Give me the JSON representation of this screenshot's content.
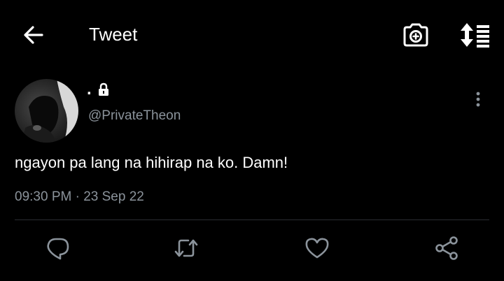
{
  "header": {
    "title": "Tweet",
    "icons": {
      "back": "arrow-left-icon",
      "camera": "camera-add-icon",
      "sort": "sort-list-icon"
    }
  },
  "tweet": {
    "display_name": ".",
    "protected_icon": "lock-icon",
    "handle": "@PrivateTheon",
    "text": "ngayon pa lang na hihirap na ko. Damn!",
    "time": "09:30 PM",
    "separator": " · ",
    "date": "23 Sep 22"
  },
  "actions": {
    "icons": [
      "reply-icon",
      "retweet-icon",
      "like-icon",
      "share-icon"
    ]
  },
  "colors": {
    "background": "#000000",
    "primary_text": "#ffffff",
    "secondary_text": "#8b939b",
    "divider": "#2a2d31",
    "icon": "#8b939b"
  }
}
